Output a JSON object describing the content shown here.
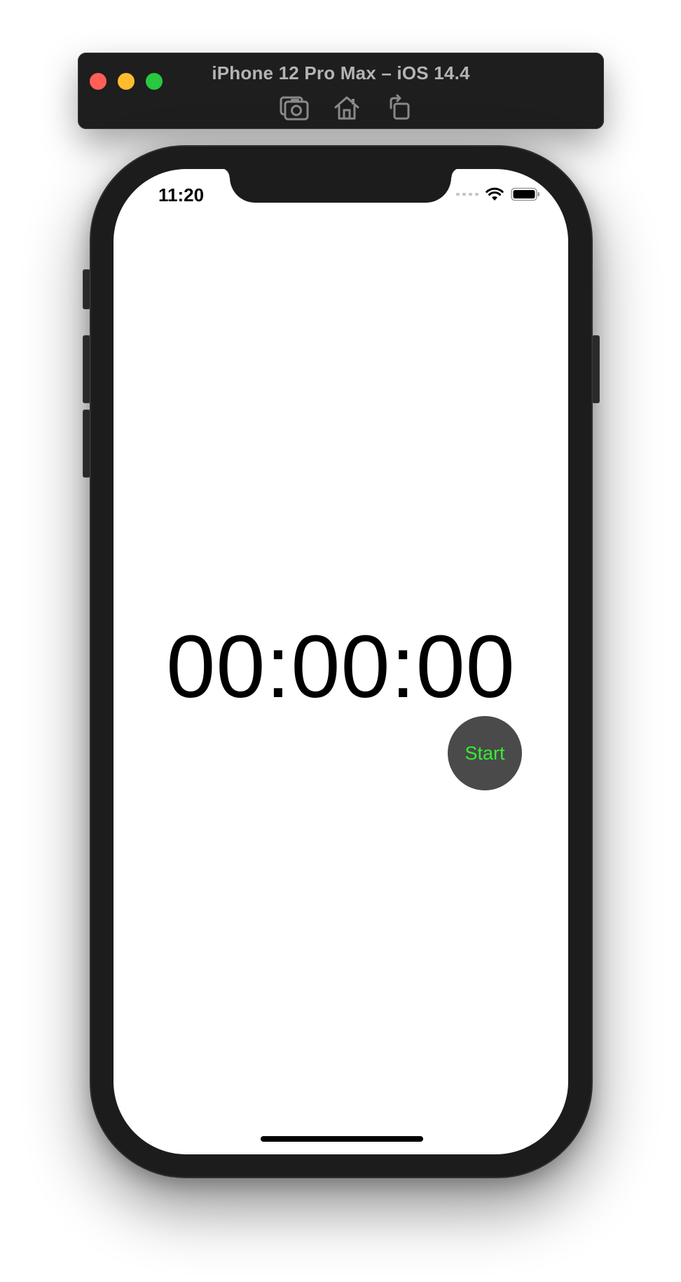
{
  "window": {
    "title": "iPhone 12 Pro Max – iOS 14.4",
    "toolbar": [
      {
        "icon": "screenshot-icon"
      },
      {
        "icon": "home-icon"
      },
      {
        "icon": "rotate-icon"
      }
    ],
    "traffic_lights": {
      "close": "#ff5f57",
      "minimize": "#febc2e",
      "zoom": "#28c840"
    }
  },
  "status_bar": {
    "time": "11:20",
    "icons": [
      "cellular-icon",
      "wifi-icon",
      "battery-icon"
    ]
  },
  "app": {
    "timer_display": "00:00:00",
    "start_button_label": "Start",
    "colors": {
      "start_button_background": "#4a4a4a",
      "start_button_text": "#33ee33"
    }
  }
}
